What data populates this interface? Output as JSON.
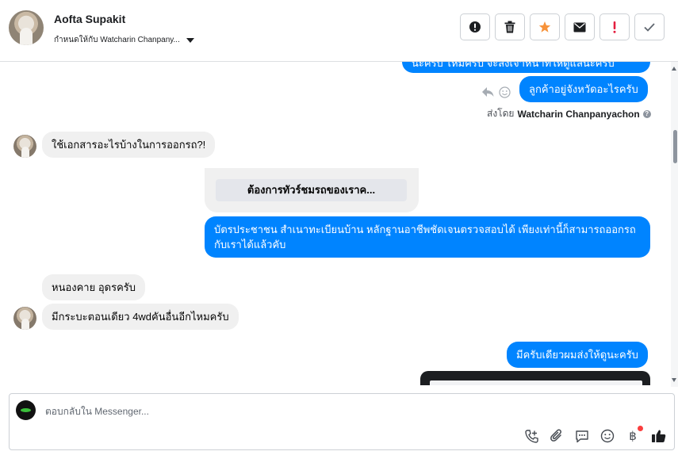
{
  "header": {
    "contact_name": "Aofta Supakit",
    "assigned_to": "กำหนดให้กับ Watcharin Chanpany...",
    "actions": [
      {
        "name": "mark-spam-button",
        "icon": "alert-circle-icon"
      },
      {
        "name": "delete-button",
        "icon": "trash-icon"
      },
      {
        "name": "star-button",
        "icon": "star-icon"
      },
      {
        "name": "mark-unread-button",
        "icon": "envelope-icon"
      },
      {
        "name": "follow-up-button",
        "icon": "exclamation-icon"
      },
      {
        "name": "mark-done-button",
        "icon": "check-icon"
      }
    ]
  },
  "messages": {
    "m1": "นะครับ ไหมครับ จะส่งเจ้าหน้าที่ให้ดูแลนะครับ",
    "m2": "ลูกค้าอยู่จังหวัดอะไรครับ",
    "sent_by_prefix": "ส่งโดย",
    "sent_by_name": "Watcharin Chanpanyachon",
    "m3": "ใช้เอกสารอะไรบ้างในการออกรถ?!",
    "card_button": "ต้องการทัวร์ชมรถของเราค...",
    "m4": "บัตรประชาชน สำเนาทะเบียนบ้าน หลักฐานอาชีพชัดเจนตรวจสอบได้ เพียงเท่านี้ก็สามารถออกรถกับเราได้แล้วคับ",
    "m5": "หนองคาย อุดรครับ",
    "m6": "มีกระบะตอนเดียว 4wdคันอื่นอีกไหมครับ",
    "m7": "มีครับเดียวผมส่งให้ดูนะครับ"
  },
  "composer": {
    "placeholder": "ตอบกลับใน Messenger..."
  },
  "colors": {
    "outgoing": "#0084ff",
    "incoming": "#f0f0f0",
    "star": "#f7923a",
    "alert": "#e41e3f"
  }
}
